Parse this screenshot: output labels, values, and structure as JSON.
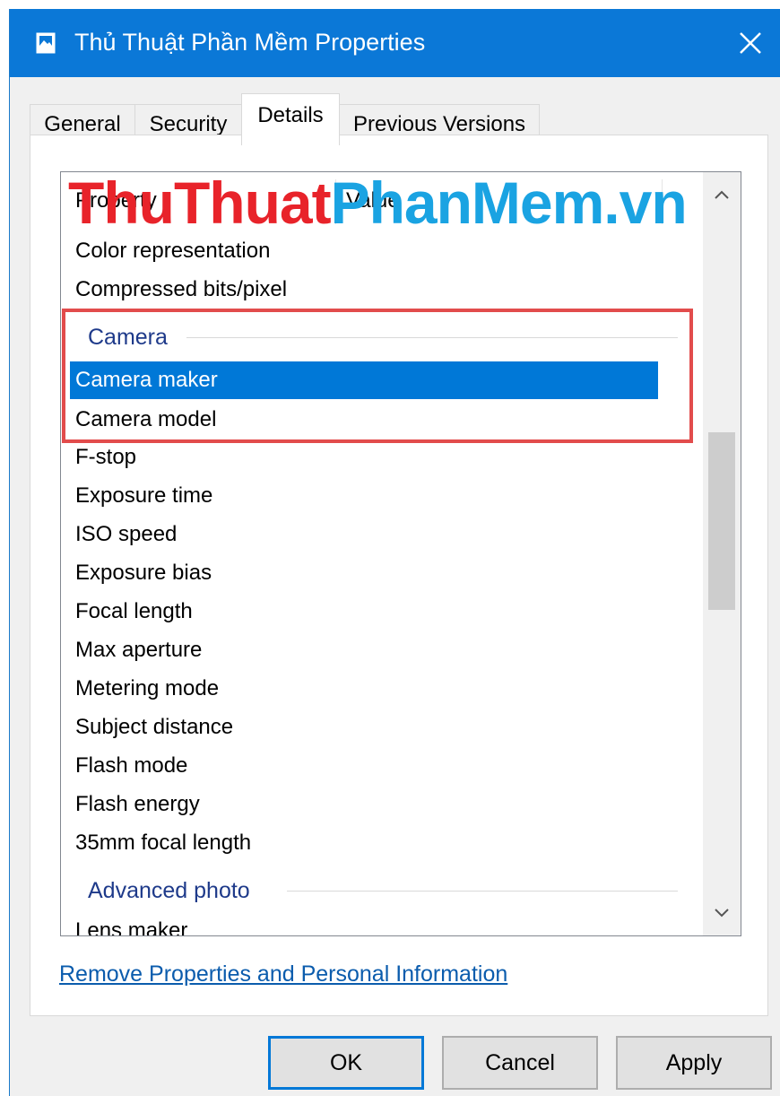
{
  "window": {
    "title": "Thủ Thuật Phần Mềm Properties",
    "accent": "#0b78d7"
  },
  "tabs": [
    {
      "label": "General",
      "active": false
    },
    {
      "label": "Security",
      "active": false
    },
    {
      "label": "Details",
      "active": true
    },
    {
      "label": "Previous Versions",
      "active": false
    }
  ],
  "details": {
    "column_property": "Property",
    "column_value": "Value",
    "watermark_red": "ThuThuat",
    "watermark_blue": "PhanMem.vn",
    "rows_top": [
      "Color representation",
      "Compressed bits/pixel"
    ],
    "group_camera": "Camera",
    "selected_row": "Camera maker",
    "rows_camera": [
      "Camera model",
      "F-stop",
      "Exposure time",
      "ISO speed",
      "Exposure bias",
      "Focal length",
      "Max aperture",
      "Metering mode",
      "Subject distance",
      "Flash mode",
      "Flash energy",
      "35mm focal length"
    ],
    "group_advanced": "Advanced photo",
    "rows_bottom": [
      "Lens maker"
    ]
  },
  "link": "Remove Properties and Personal Information",
  "buttons": {
    "ok": "OK",
    "cancel": "Cancel",
    "apply": "Apply"
  }
}
